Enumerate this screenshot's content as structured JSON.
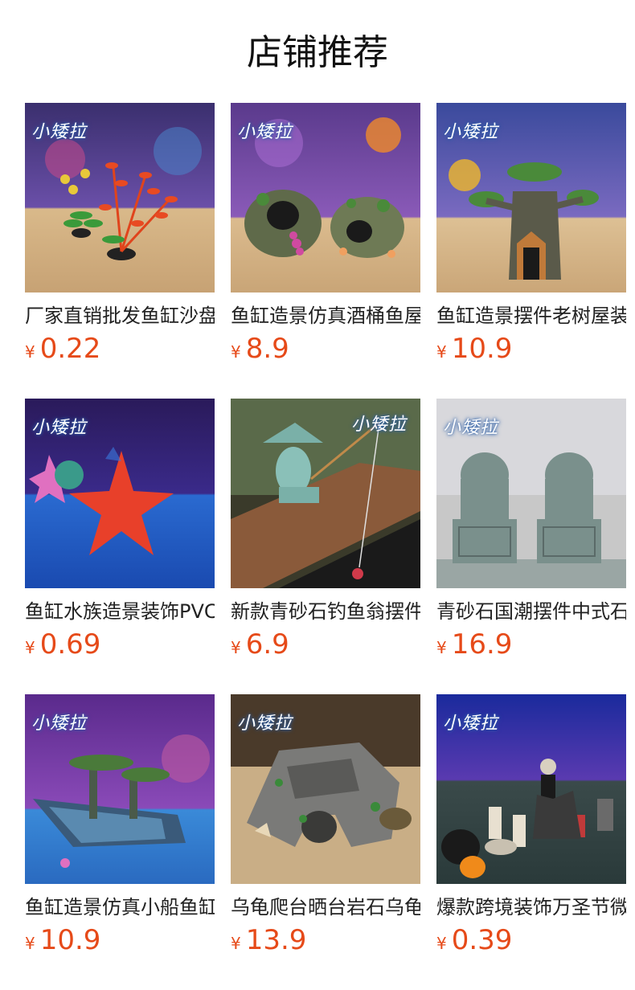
{
  "page": {
    "title": "店铺推荐"
  },
  "theme": {
    "price_color": "#e64a19"
  },
  "products": [
    {
      "name": "厂家直销批发鱼缸沙盘水草装饰",
      "currency": "¥",
      "price": "0.22",
      "image": "aquarium-plastic-plants-photo",
      "logo": "小矮拉"
    },
    {
      "name": "鱼缸造景仿真酒桶鱼屋装饰摆件",
      "currency": "¥",
      "price": "8.9",
      "image": "aquarium-barrel-ornament-photo",
      "logo": "小矮拉"
    },
    {
      "name": "鱼缸造景摆件老树屋装饰摆件",
      "currency": "¥",
      "price": "10.9",
      "image": "aquarium-tree-house-photo",
      "logo": "小矮拉"
    },
    {
      "name": "鱼缸水族造景装饰PVC海星摆件",
      "currency": "¥",
      "price": "0.69",
      "image": "red-starfish-photo",
      "logo": "小矮拉"
    },
    {
      "name": "新款青砂石钓鱼翁摆件鱼缸装饰",
      "currency": "¥",
      "price": "6.9",
      "image": "fisherman-figurine-photo",
      "logo": "小矮拉"
    },
    {
      "name": "青砂石国潮摆件中式石狮子装饰",
      "currency": "¥",
      "price": "16.9",
      "image": "stone-lion-pair-photo",
      "logo": "小矮拉"
    },
    {
      "name": "鱼缸造景仿真小船鱼缸装饰摆件",
      "currency": "¥",
      "price": "10.9",
      "image": "shipwreck-ornament-photo",
      "logo": "小矮拉"
    },
    {
      "name": "乌龟爬台晒台岩石乌龟造景摆件",
      "currency": "¥",
      "price": "13.9",
      "image": "turtle-basking-rock-photo",
      "logo": "小矮拉"
    },
    {
      "name": "爆款跨境装饰万圣节微景观摆件",
      "currency": "¥",
      "price": "0.39",
      "image": "halloween-miniatures-photo",
      "logo": "小矮拉"
    }
  ]
}
